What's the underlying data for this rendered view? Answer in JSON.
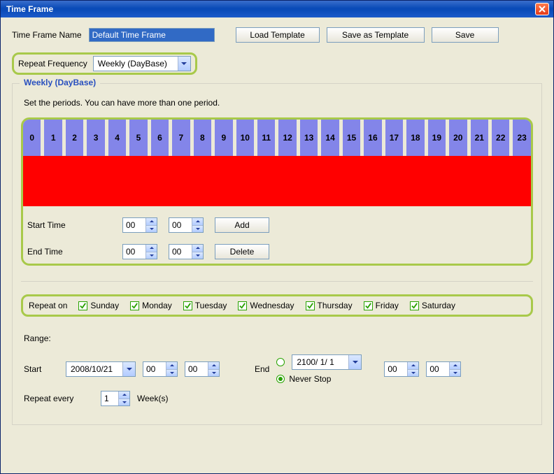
{
  "titlebar": {
    "title": "Time Frame"
  },
  "header": {
    "name_label": "Time Frame Name",
    "name_value": "Default Time Frame",
    "load_template_btn": "Load Template",
    "save_template_btn": "Save as Template",
    "save_btn": "Save"
  },
  "frequency": {
    "label": "Repeat Frequency",
    "value": "Weekly (DayBase)"
  },
  "weekly": {
    "legend": "Weekly (DayBase)",
    "instruction": "Set the periods. You can have more than one period.",
    "hours": [
      "0",
      "1",
      "2",
      "3",
      "4",
      "5",
      "6",
      "7",
      "8",
      "9",
      "10",
      "11",
      "12",
      "13",
      "14",
      "15",
      "16",
      "17",
      "18",
      "19",
      "20",
      "21",
      "22",
      "23"
    ],
    "start_time_label": "Start Time",
    "end_time_label": "End Time",
    "start_hour": "00",
    "start_min": "00",
    "end_hour": "00",
    "end_min": "00",
    "add_btn": "Add",
    "delete_btn": "Delete"
  },
  "repeat_on": {
    "label": "Repeat on",
    "days": [
      {
        "label": "Sunday",
        "checked": true
      },
      {
        "label": "Monday",
        "checked": true
      },
      {
        "label": "Tuesday",
        "checked": true
      },
      {
        "label": "Wednesday",
        "checked": true
      },
      {
        "label": "Thursday",
        "checked": true
      },
      {
        "label": "Friday",
        "checked": true
      },
      {
        "label": "Saturday",
        "checked": true
      }
    ]
  },
  "range": {
    "title": "Range:",
    "start_label": "Start",
    "start_date": "2008/10/21",
    "start_hour": "00",
    "start_min": "00",
    "end_label": "End",
    "end_date": "2100/ 1/ 1",
    "end_hour": "00",
    "end_min": "00",
    "never_stop_label": "Never Stop",
    "end_mode": "never_stop",
    "repeat_every_label": "Repeat every",
    "repeat_every_value": "1",
    "repeat_every_unit": "Week(s)"
  }
}
